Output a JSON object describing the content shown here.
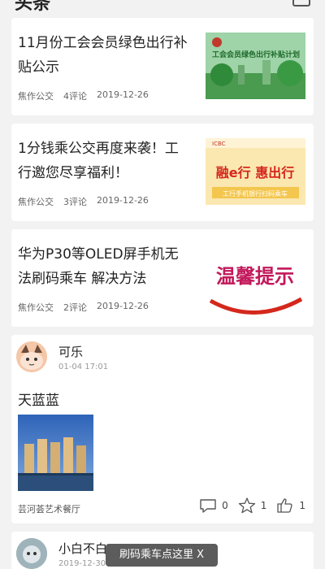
{
  "header": {
    "title": "头条"
  },
  "news": [
    {
      "title": "11月份工会会员绿色出行补贴公示",
      "source": "焦作公交",
      "comments": "4评论",
      "date": "2019-12-26",
      "image_label": "工会会员绿色出行补贴计划"
    },
    {
      "title": "1分钱乘公交再度来袭！工行邀您尽享福利！",
      "source": "焦作公交",
      "comments": "3评论",
      "date": "2019-12-26",
      "image_label": "融e行 惠出行",
      "image_sub": "工行手机银行扫码乘车"
    },
    {
      "title": "华为P30等OLED屏手机无法刷码乘车 解决方法",
      "source": "焦作公交",
      "comments": "2评论",
      "date": "2019-12-26",
      "image_label": "温馨提示"
    }
  ],
  "post": {
    "author": "可乐",
    "time": "01-04 17:01",
    "text": "天蓝蓝",
    "location": "芸河荟艺术餐厅",
    "comment_count": "0",
    "star_count": "1",
    "like_count": "1"
  },
  "post2": {
    "author": "小白不白",
    "time": "2019-12-30"
  },
  "toast": {
    "text": "刷码乘车点这里 X"
  },
  "colors": {
    "card_bg": "#ffffff",
    "page_bg": "#f2f2f2",
    "meta": "#666666"
  }
}
